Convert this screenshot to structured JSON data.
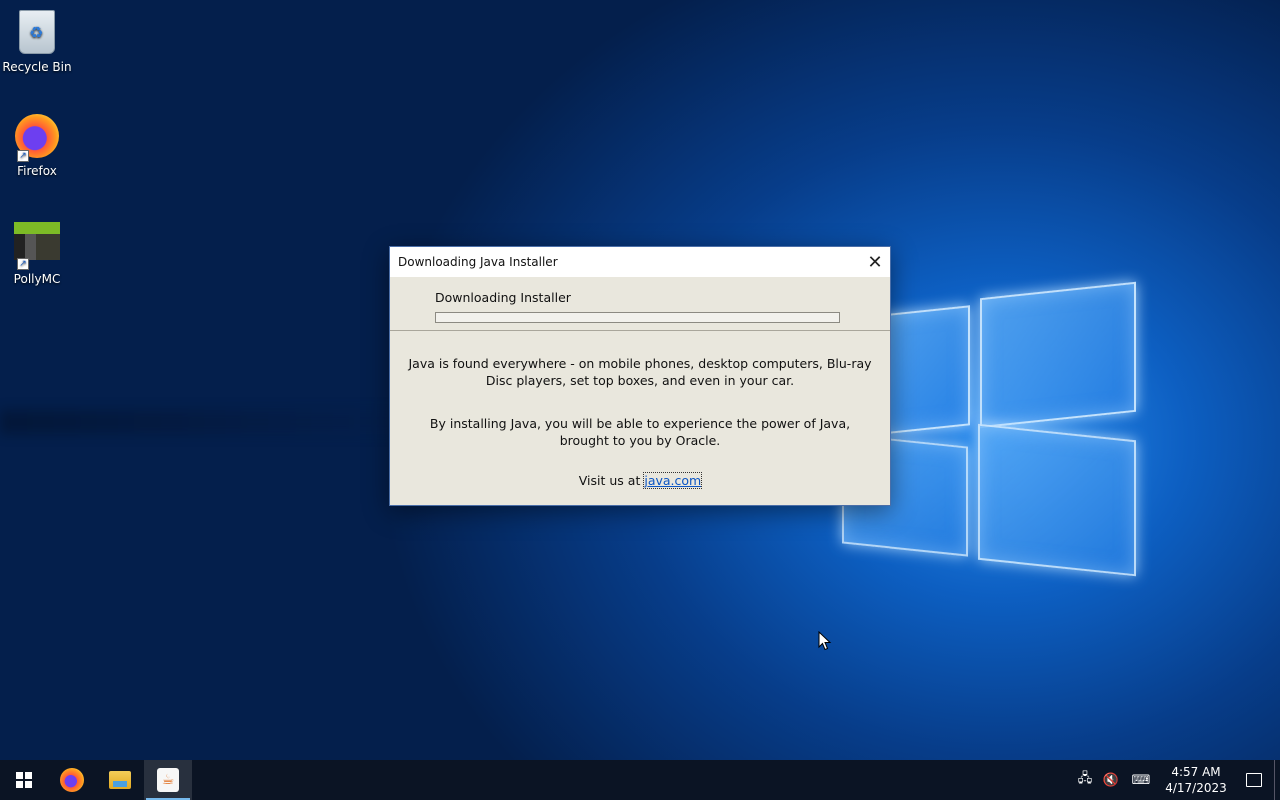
{
  "desktop": {
    "icons": [
      {
        "label": "Recycle Bin",
        "icon": "recycle-bin-icon"
      },
      {
        "label": "Firefox",
        "icon": "firefox-icon"
      },
      {
        "label": "PollyMC",
        "icon": "pollymc-icon"
      }
    ]
  },
  "dialog": {
    "title": "Downloading Java Installer",
    "status": "Downloading Installer",
    "progress": 0,
    "paragraph1": "Java is found everywhere - on mobile phones, desktop computers, Blu-ray Disc players, set top boxes, and even in your car.",
    "paragraph2": "By installing Java, you will be able to experience the power of Java, brought to you by Oracle.",
    "visit_prefix": "Visit us at",
    "link_text": "java.com"
  },
  "taskbar": {
    "apps": [
      "start-icon",
      "firefox-icon",
      "file-explorer-icon",
      "java-icon"
    ],
    "active_app": "java-icon",
    "time": "4:57 AM",
    "date": "4/17/2023"
  },
  "colors": {
    "accent": "#76b9ed",
    "link": "#0b55c4",
    "dialog_bg": "#e9e7dd",
    "taskbar_bg": "#0b1424"
  }
}
